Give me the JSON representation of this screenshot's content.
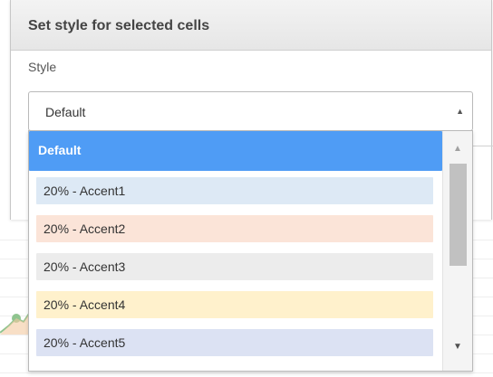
{
  "dialog": {
    "title": "Set style for selected cells",
    "style_label": "Style"
  },
  "select": {
    "value": "Default",
    "arrow_icon": "triangle-up-icon"
  },
  "dropdown": {
    "options": [
      {
        "label": "Default",
        "selected": true,
        "color": "#4f9cf5"
      },
      {
        "label": "20% - Accent1",
        "selected": false,
        "color": "#dde9f5"
      },
      {
        "label": "20% - Accent2",
        "selected": false,
        "color": "#fbe4d8"
      },
      {
        "label": "20% - Accent3",
        "selected": false,
        "color": "#ececec"
      },
      {
        "label": "20% - Accent4",
        "selected": false,
        "color": "#fff1cc"
      },
      {
        "label": "20% - Accent5",
        "selected": false,
        "color": "#dce2f3"
      }
    ],
    "scroll_up_icon": "triangle-up-icon",
    "scroll_down_icon": "triangle-down-icon"
  }
}
